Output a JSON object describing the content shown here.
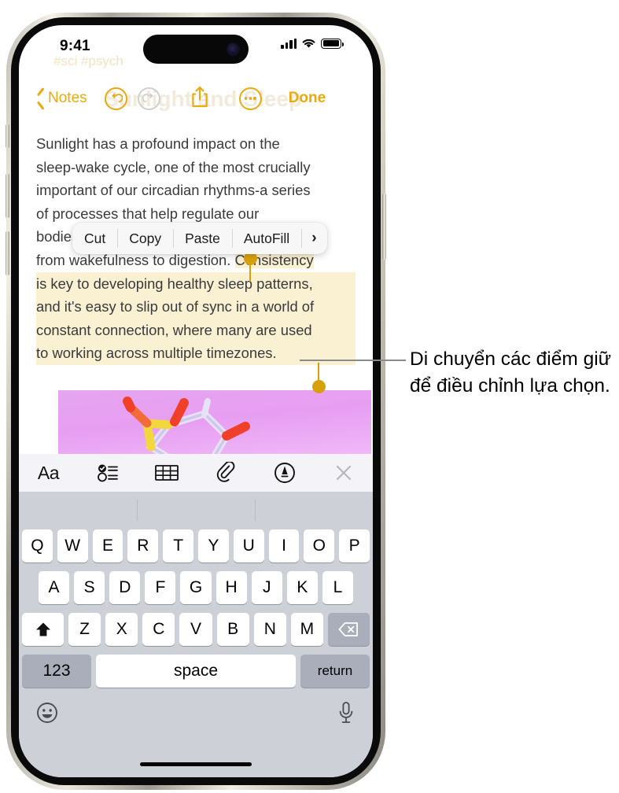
{
  "status_bar": {
    "time": "9:41",
    "cellular_icon": "cellular-bars-icon",
    "wifi_icon": "wifi-icon",
    "battery_icon": "battery-full-icon"
  },
  "note_background": {
    "tags": "#sci #psych",
    "title": "Sunlight and Sleep"
  },
  "navbar": {
    "back_label": "Notes",
    "undo_icon": "undo-arrow-icon",
    "redo_icon": "redo-arrow-icon",
    "share_icon": "share-icon",
    "more_icon": "more-ellipsis-icon",
    "done_label": "Done"
  },
  "note": {
    "lines": [
      "Sunlight has a profound impact on the",
      "sleep-wake cycle, one of the most crucially",
      "important of our circadian rhythms-a series",
      "of processes that help regulate our",
      "bodies' functions to optimize everything",
      "from wakefulness to digestion. "
    ],
    "selected_start_fragment": "Consistency",
    "selected_lines": [
      "is key to developing healthy sleep patterns,",
      "and it's easy to slip out of sync in a world of",
      "constant connection, where many are used",
      "to working across multiple timezones."
    ],
    "attachment": "molecule-image"
  },
  "edit_menu": {
    "items": [
      {
        "label": "Cut",
        "name": "menu-item-cut"
      },
      {
        "label": "Copy",
        "name": "menu-item-copy"
      },
      {
        "label": "Paste",
        "name": "menu-item-paste"
      },
      {
        "label": "AutoFill",
        "name": "menu-item-autofill"
      },
      {
        "label": "›",
        "name": "menu-item-more-arrow"
      }
    ]
  },
  "format_toolbar": {
    "items": [
      {
        "label": "Aa",
        "name": "format-text-button"
      },
      {
        "label": "",
        "name": "checklist-button"
      },
      {
        "label": "",
        "name": "table-button"
      },
      {
        "label": "",
        "name": "attachment-button"
      },
      {
        "label": "",
        "name": "markup-pen-button"
      },
      {
        "label": "",
        "name": "close-toolbar-button"
      }
    ]
  },
  "keyboard": {
    "row1": [
      "Q",
      "W",
      "E",
      "R",
      "T",
      "Y",
      "U",
      "I",
      "O",
      "P"
    ],
    "row2": [
      "A",
      "S",
      "D",
      "F",
      "G",
      "H",
      "J",
      "K",
      "L"
    ],
    "row3": [
      "Z",
      "X",
      "C",
      "V",
      "B",
      "N",
      "M"
    ],
    "shift_icon": "shift-arrow-icon",
    "backspace_icon": "backspace-icon",
    "numbers_label": "123",
    "space_label": "space",
    "return_label": "return",
    "emoji_icon": "emoji-smiley-icon",
    "mic_icon": "microphone-icon"
  },
  "callout": {
    "text": "Di chuyển các điểm giữ để điều chỉnh lựa chọn."
  },
  "colors": {
    "accent_yellow": "#E8AA0E",
    "handle_gold": "#D9A00B",
    "selection_highlight": "#faf0d2",
    "keyboard_bg": "#cdd0d7",
    "special_key": "#a9aeba"
  }
}
